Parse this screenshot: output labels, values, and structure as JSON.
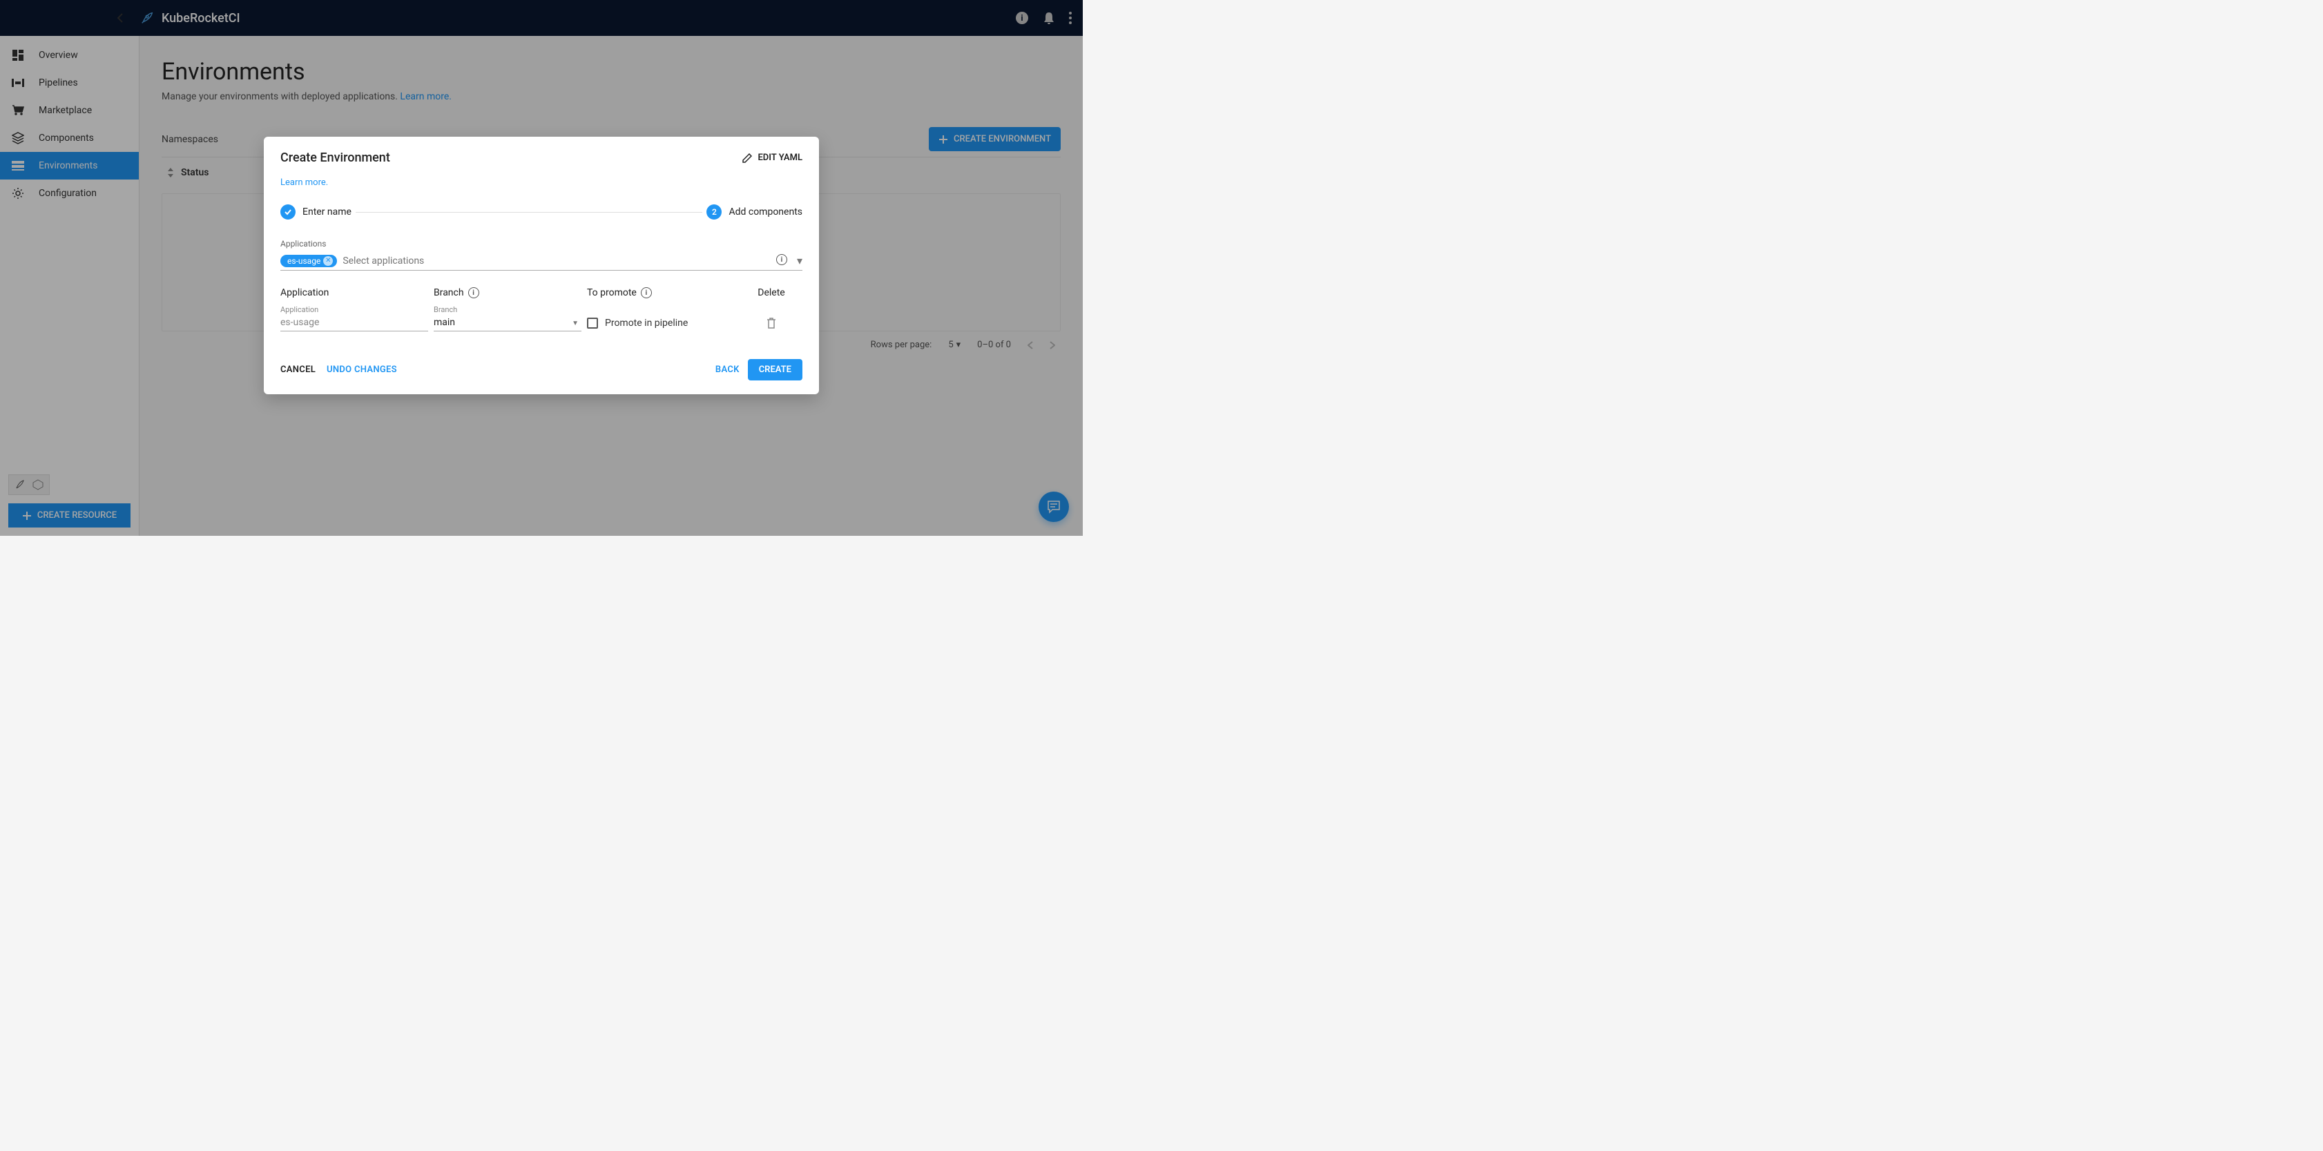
{
  "brand": "KubeRocketCI",
  "sidebar": {
    "items": [
      {
        "label": "Overview"
      },
      {
        "label": "Pipelines"
      },
      {
        "label": "Marketplace"
      },
      {
        "label": "Components"
      },
      {
        "label": "Environments"
      },
      {
        "label": "Configuration"
      }
    ],
    "create_resource": "CREATE RESOURCE"
  },
  "page": {
    "title": "Environments",
    "subtitle_text": "Manage your environments with deployed applications. ",
    "subtitle_link": "Learn more.",
    "tab": "Namespaces",
    "create_button": "CREATE ENVIRONMENT",
    "status_header": "Status",
    "pagination": {
      "rows_label": "Rows per page:",
      "page_size": "5",
      "range": "0–0 of 0"
    }
  },
  "modal": {
    "title": "Create Environment",
    "edit_yaml": "EDIT YAML",
    "learn_more": "Learn more.",
    "step1": "Enter name",
    "step2_num": "2",
    "step2": "Add components",
    "applications_label": "Applications",
    "chip": "es-usage",
    "applications_placeholder": "Select applications",
    "cols": {
      "application": "Application",
      "branch": "Branch",
      "to_promote": "To promote",
      "delete": "Delete"
    },
    "row": {
      "app_label": "Application",
      "app_value": "es-usage",
      "branch_label": "Branch",
      "branch_value": "main",
      "promote_label": "Promote in pipeline"
    },
    "footer": {
      "cancel": "CANCEL",
      "undo": "UNDO CHANGES",
      "back": "BACK",
      "create": "CREATE"
    }
  }
}
